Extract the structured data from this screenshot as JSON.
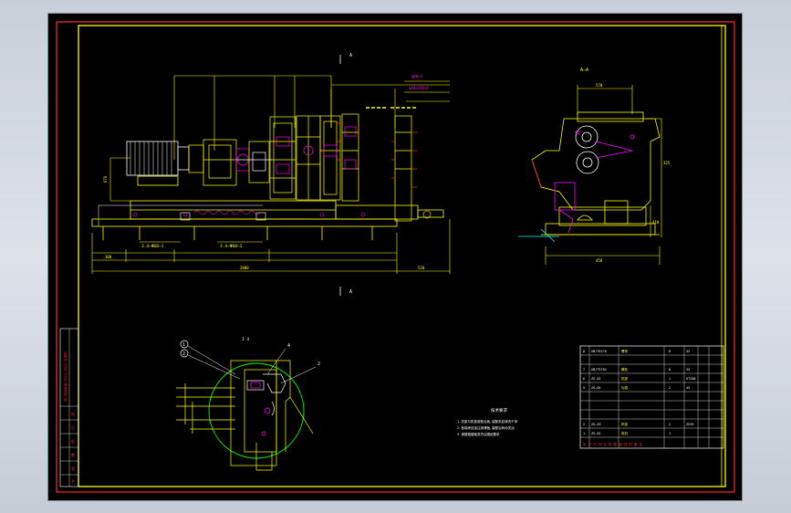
{
  "colors": {
    "background": "#000000",
    "outer_frame": "#ff2a2a",
    "inner_frame": "#ffff00",
    "drawing_primary": "#ffff00",
    "drawing_accent": "#ff00ff",
    "drawing_secondary": "#ffffff",
    "drawing_green": "#00ff00",
    "cyan_lines": "#00ffff"
  },
  "main_view": {
    "section_markers": [
      "A",
      "A"
    ],
    "dimension_labels": {
      "top_right_1": "φ40×1",
      "top_right_2": "φ40×180×1",
      "callout_left": "3.4—Φ60—1",
      "callout_mid": "3.4—Φ60—1",
      "left_height": "670",
      "total_length": "2800",
      "left_offset": "300",
      "right_offset": "520"
    }
  },
  "section_view": {
    "title": "A—A",
    "dimension_labels": {
      "width_top": "570",
      "right_height_1": "325",
      "right_height_2": "410",
      "bottom": "450"
    }
  },
  "detail_view": {
    "title": "I  4",
    "balloons": [
      "1",
      "2",
      "4",
      "2"
    ]
  },
  "notes": {
    "heading": "技术要求",
    "items": [
      "1. 机架与机座各配合面, 装配前应清洗干净",
      "2. 各轴承处加注润滑脂, 装配后转动灵活",
      "3. 调整辊缝使其符合图纸要求"
    ]
  },
  "bom": {
    "header": "序号   代号   名称   数量   材料   备注",
    "rows": [
      {
        "no": "8",
        "code": "GB/T6170",
        "name": "螺母",
        "qty": "8",
        "mat": "35"
      },
      {
        "no": "7",
        "code": "GB/T5782",
        "name": "螺栓",
        "qty": "8",
        "mat": "35"
      },
      {
        "no": "6",
        "code": "ZG-02",
        "name": "机座",
        "qty": "1",
        "mat": "HT200"
      },
      {
        "no": "5",
        "code": "ZG-05",
        "name": "轧辊",
        "qty": "2",
        "mat": "45"
      },
      {
        "no": "2",
        "code": "ZG-03",
        "name": "机架",
        "qty": "2",
        "mat": "ZG35"
      },
      {
        "no": "1",
        "code": "ZG-01",
        "name": "电机",
        "qty": "1",
        "mat": ""
      }
    ],
    "footer": "序 号 代 号 名 称 数 量 材 料 备 注"
  },
  "side_block": {
    "vertical_text": "ZG_DRAWING  MILL-ASSY  标准件",
    "cells": [
      "标",
      "记",
      "处",
      "数",
      "签",
      "名"
    ]
  }
}
